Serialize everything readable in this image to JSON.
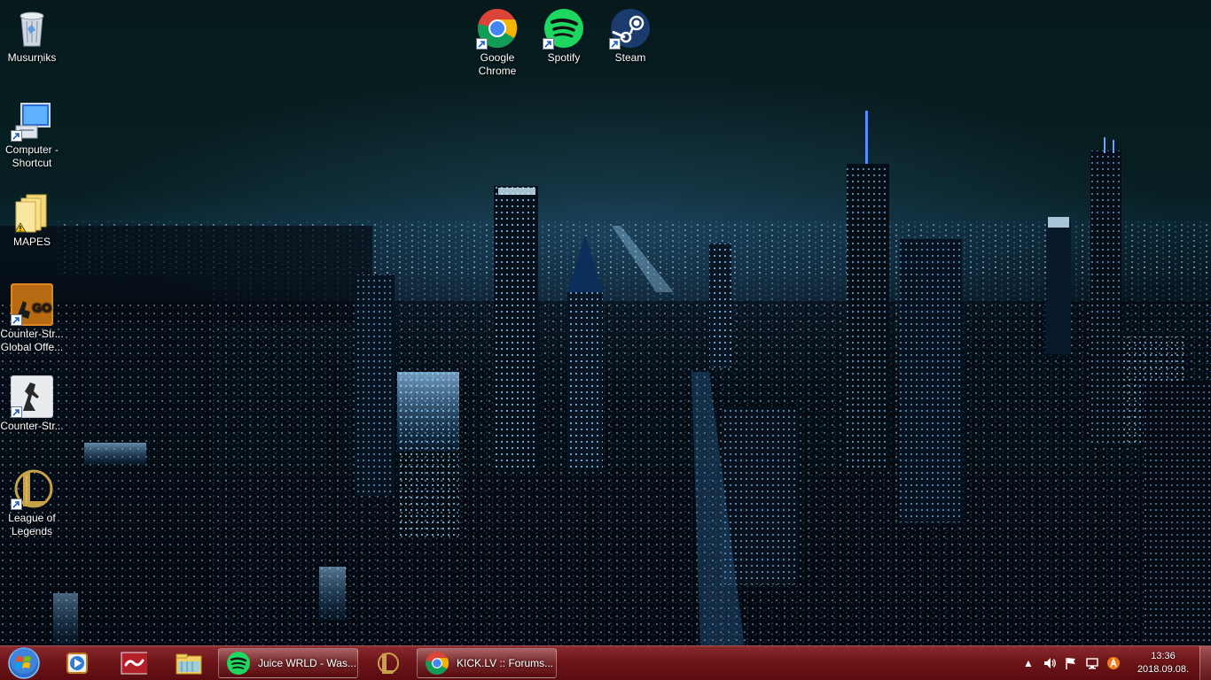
{
  "desktop": {
    "icons": [
      {
        "label": "Musurņiks",
        "icon": "recycle-bin-icon"
      },
      {
        "label": "Computer - Shortcut",
        "icon": "computer-icon"
      },
      {
        "label": "MAPES",
        "icon": "folder-icon"
      },
      {
        "label": "Counter-Str... Global Offe...",
        "icon": "csgo-icon"
      },
      {
        "label": "Counter-Str...",
        "icon": "counter-strike-icon"
      },
      {
        "label": "League of Legends",
        "icon": "league-of-legends-icon"
      },
      {
        "label": "Google Chrome",
        "icon": "chrome-icon"
      },
      {
        "label": "Spotify",
        "icon": "spotify-icon"
      },
      {
        "label": "Steam",
        "icon": "steam-icon"
      }
    ]
  },
  "taskbar": {
    "pinned": [
      {
        "icon": "media-player-icon"
      },
      {
        "icon": "app-tilde-icon"
      },
      {
        "icon": "file-explorer-icon"
      },
      {
        "icon": "league-of-legends-icon"
      }
    ],
    "windows": [
      {
        "label": "Juice WRLD - Was...",
        "icon": "spotify-icon"
      },
      {
        "label": "KICK.LV :: Forums...",
        "icon": "chrome-icon"
      }
    ],
    "tray": {
      "time": "13:36",
      "date": "2018.09.08."
    }
  },
  "colors": {
    "taskbar": "#6d1518",
    "spotify": "#1ed760",
    "steam": "#1b2838"
  }
}
